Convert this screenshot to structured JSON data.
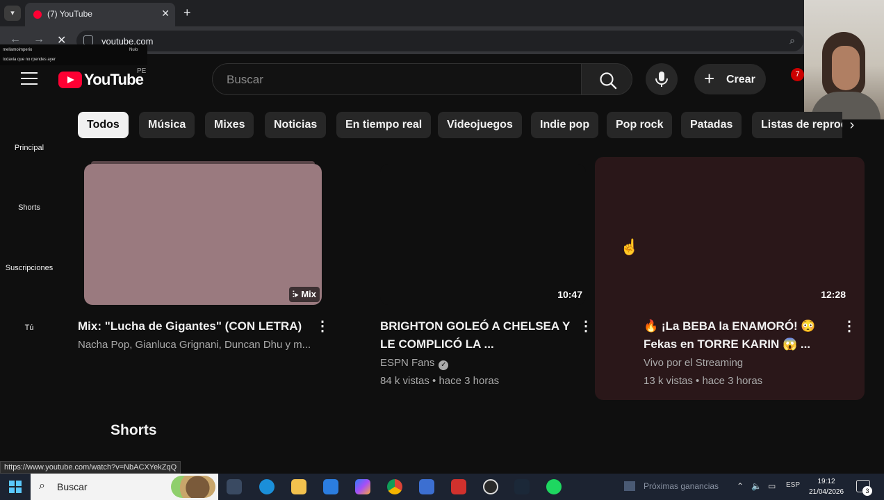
{
  "browser": {
    "tab_title": "(7) YouTube",
    "url": "youtube.com",
    "status_url": "https://www.youtube.com/watch?v=NbACXYekZqQ",
    "notification_lines": [
      "mellamoimperio",
      "todavia que no rpendes ayer"
    ],
    "notification_tag": "Nulo"
  },
  "youtube": {
    "logo_text": "YouTube",
    "country_code": "PE",
    "search_placeholder": "Buscar",
    "create_label": "Crear",
    "notification_count": "7",
    "sidebar": [
      {
        "label": "Principal"
      },
      {
        "label": "Shorts"
      },
      {
        "label": "Suscripciones"
      },
      {
        "label": "Tú"
      }
    ],
    "chips": [
      {
        "label": "Todos",
        "active": true
      },
      {
        "label": "Música"
      },
      {
        "label": "Mixes"
      },
      {
        "label": "Noticias"
      },
      {
        "label": "En tiempo real"
      },
      {
        "label": "Videojuegos"
      },
      {
        "label": "Indie pop"
      },
      {
        "label": "Pop rock"
      },
      {
        "label": "Patadas"
      },
      {
        "label": "Listas de reproducción"
      }
    ],
    "videos": [
      {
        "title": "Mix: \"Lucha de Gigantes\" (CON LETRA)",
        "channel": "Nacha Pop, Gianluca Grignani, Duncan Dhu y m...",
        "badge": "Mix"
      },
      {
        "title_line1": "BRIGHTON GOLEÓ A CHELSEA Y",
        "title_line2": "LE COMPLICÓ LA ...",
        "channel": "ESPN Fans",
        "stats": "84 k vistas • hace 3 horas",
        "duration": "10:47"
      },
      {
        "title_line1": "🔥 ¡La BEBA la ENAMORÓ! 😳",
        "title_line2": "Fekas en TORRE KARIN 😱 ...",
        "channel": "Vivo por el Streaming",
        "stats": "13 k vistas • hace 3 horas",
        "duration": "12:28"
      }
    ],
    "shorts_heading": "Shorts"
  },
  "taskbar": {
    "search_label": "Buscar",
    "widget_text": "Próximas ganancias",
    "language": "ESP",
    "time": "19:12",
    "date": "21/04/2026",
    "notification_count": "3"
  },
  "colors": {
    "background": "#0f0f0f",
    "brand_red": "#ff0033",
    "hover_card": "#2a1719",
    "chip": "#272727",
    "taskbar": "#1c2331"
  }
}
